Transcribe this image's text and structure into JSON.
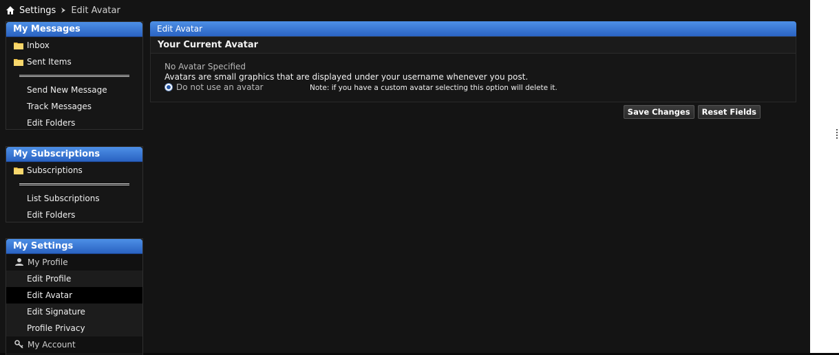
{
  "breadcrumb": {
    "home_icon": "home-icon",
    "root": "Settings",
    "separator_icon": "arrow-icon",
    "current": "Edit Avatar"
  },
  "sidebar": {
    "messages": {
      "title": "My Messages",
      "folders": [
        {
          "label": "Inbox",
          "icon": "folder-icon"
        },
        {
          "label": "Sent Items",
          "icon": "folder-icon"
        }
      ],
      "actions": [
        {
          "label": "Send New Message"
        },
        {
          "label": "Track Messages"
        },
        {
          "label": "Edit Folders"
        }
      ]
    },
    "subscriptions": {
      "title": "My Subscriptions",
      "folders": [
        {
          "label": "Subscriptions",
          "icon": "folder-icon"
        }
      ],
      "actions": [
        {
          "label": "List Subscriptions"
        },
        {
          "label": "Edit Folders"
        }
      ]
    },
    "settings": {
      "title": "My Settings",
      "profile": {
        "label": "My Profile",
        "icon": "user-icon"
      },
      "profile_items": [
        {
          "label": "Edit Profile"
        },
        {
          "label": "Edit Avatar",
          "active": true
        },
        {
          "label": "Edit Signature"
        },
        {
          "label": "Profile Privacy"
        }
      ],
      "account": {
        "label": "My Account",
        "icon": "key-icon"
      }
    }
  },
  "main": {
    "panel_title": "Edit Avatar",
    "section_title": "Your Current Avatar",
    "no_avatar": "No Avatar Specified",
    "description": "Avatars are small graphics that are displayed under your username whenever you post.",
    "radio_label": "Do not use an avatar",
    "note": "Note: if you have a custom avatar selecting this option will delete it.",
    "save_label": "Save Changes",
    "reset_label": "Reset Fields"
  },
  "colors": {
    "accent_blue": "#2a63c2",
    "background": "#141414",
    "active_item": "#000000"
  }
}
